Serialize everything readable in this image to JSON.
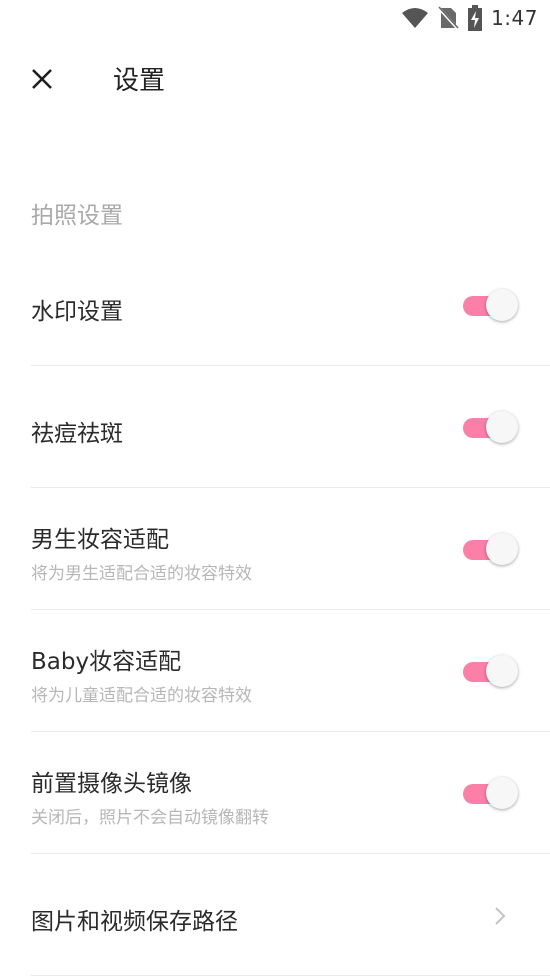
{
  "status_bar": {
    "time": "1:47",
    "icons": [
      "wifi-icon",
      "no-sim-icon",
      "battery-charging-icon"
    ]
  },
  "header": {
    "title": "设置",
    "close_icon": "close-icon"
  },
  "section": {
    "label": "拍照设置"
  },
  "settings": [
    {
      "title": "水印设置",
      "subtitle": "",
      "control": "toggle",
      "enabled": true
    },
    {
      "title": "祛痘祛斑",
      "subtitle": "",
      "control": "toggle",
      "enabled": true
    },
    {
      "title": "男生妆容适配",
      "subtitle": "将为男生适配合适的妆容特效",
      "control": "toggle",
      "enabled": true
    },
    {
      "title": "Baby妆容适配",
      "subtitle": "将为儿童适配合适的妆容特效",
      "control": "toggle",
      "enabled": true
    },
    {
      "title": "前置摄像头镜像",
      "subtitle": "关闭后，照片不会自动镜像翻转",
      "control": "toggle",
      "enabled": true
    },
    {
      "title": "图片和视频保存路径",
      "subtitle": "",
      "control": "chevron"
    }
  ],
  "colors": {
    "toggle_on": "#fb7fa7",
    "section_header": "#a9a9a9",
    "subtitle": "#b7b7b7",
    "divider": "#ebebeb"
  }
}
